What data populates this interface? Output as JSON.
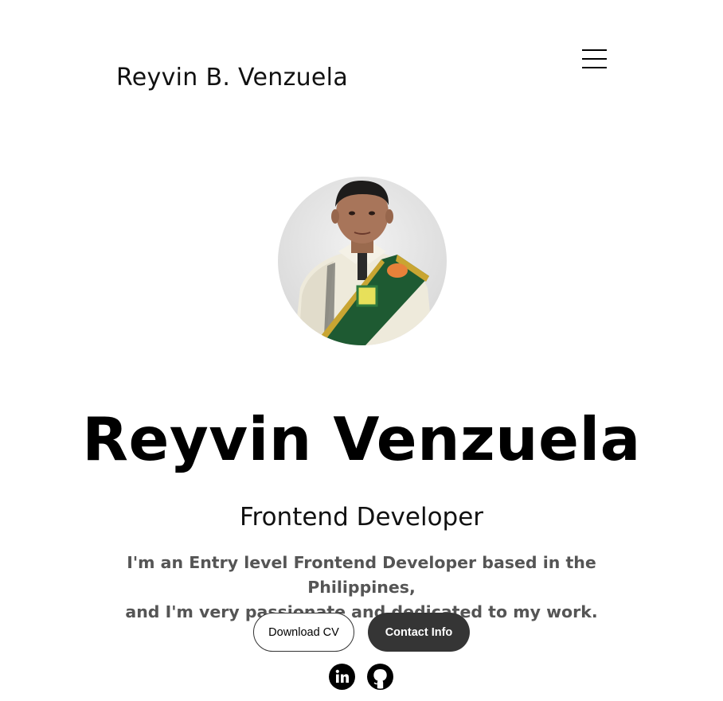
{
  "header": {
    "logo_text": "Reyvin B. Venzuela",
    "menu_icon": "hamburger-menu-icon"
  },
  "hero": {
    "profile_image": "profile-photo",
    "name": "Reyvin Venzuela",
    "role": "Frontend Developer",
    "bio_line1": "I'm an Entry level Frontend Developer based in the Philippines,",
    "bio_line2": "and I'm very passionate and dedicated to my work.",
    "buttons": {
      "download_cv": "Download CV",
      "contact_info": "Contact Info"
    },
    "socials": [
      {
        "icon": "linkedin-icon"
      },
      {
        "icon": "github-icon"
      }
    ]
  },
  "colors": {
    "primary_button_bg": "#353535",
    "text_muted": "#555555",
    "sash_green": "#1e5a32"
  }
}
